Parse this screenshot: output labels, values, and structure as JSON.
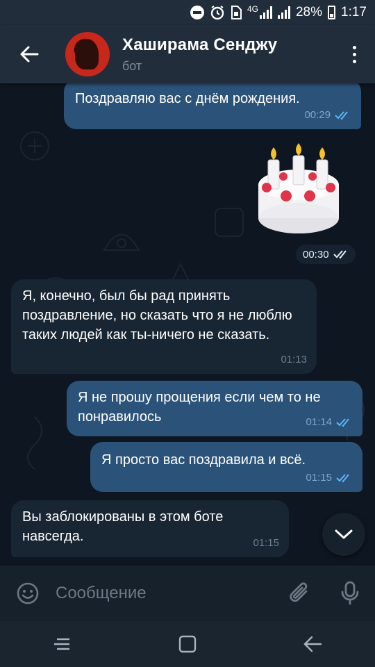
{
  "status_bar": {
    "network": "4G",
    "battery": "28%",
    "time": "1:17"
  },
  "header": {
    "title": "Хаширама Сенджу",
    "subtitle": "бот"
  },
  "messages": [
    {
      "direction": "out",
      "text": "Поздравляю вас с днём рождения.",
      "time": "00:29",
      "read": true
    },
    {
      "direction": "out",
      "type": "sticker",
      "sticker": "birthday-cake",
      "time": "00:30",
      "read": true
    },
    {
      "direction": "in",
      "text": "Я, конечно, был бы рад принять поздравление, но сказать что я не люблю таких людей как ты-ничего не сказать.",
      "time": "01:13"
    },
    {
      "direction": "out",
      "text": "Я не прошу прощения если чем то не понравилось",
      "time": "01:14",
      "read": true
    },
    {
      "direction": "out",
      "text": "Я просто вас поздравила и всё.",
      "time": "01:15",
      "read": true
    },
    {
      "direction": "in",
      "text": "Вы заблокированы в этом боте навсегда.",
      "time": "01:15"
    }
  ],
  "input": {
    "placeholder": "Сообщение"
  },
  "colors": {
    "background": "#0e1621",
    "header": "#212d3b",
    "outgoing_bubble": "#2b5278",
    "incoming_bubble": "#182533",
    "accent": "#5eb5f7"
  },
  "icons": {
    "back": "arrow-left-icon",
    "menu": "kebab-menu-icon",
    "emoji": "smile-icon",
    "attach": "paperclip-icon",
    "mic": "microphone-icon",
    "scroll": "chevron-down-icon"
  }
}
